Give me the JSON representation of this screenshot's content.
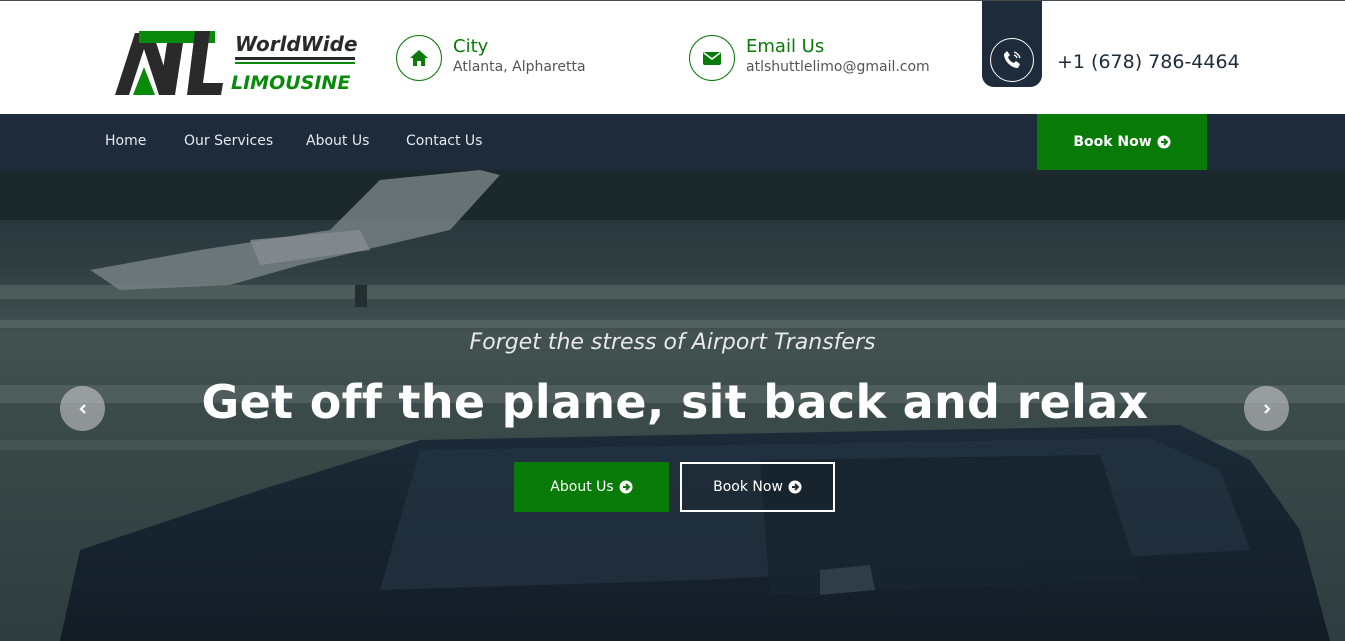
{
  "brand": {
    "logo_text": "ATL",
    "logo_line1": "WorldWide",
    "logo_line2": "LIMOUSINE"
  },
  "header": {
    "city": {
      "icon": "home-icon",
      "title": "City",
      "value": "Atlanta, Alpharetta"
    },
    "email": {
      "icon": "envelope-icon",
      "title": "Email Us",
      "value": "atlshuttlelimo@gmail.com"
    },
    "phone": {
      "icon": "phone-icon",
      "value": "+1 (678) 786-4464"
    }
  },
  "nav": {
    "items": [
      {
        "label": "Home"
      },
      {
        "label": "Our Services"
      },
      {
        "label": "About Us"
      },
      {
        "label": "Contact Us"
      }
    ],
    "book_label": "Book Now"
  },
  "hero": {
    "subtitle": "Forget the stress of Airport Transfers",
    "title": "Get off the plane, sit back and relax",
    "buttons": {
      "about_label": "About Us",
      "book_label": "Book Now"
    },
    "prev_icon": "chevron-left-icon",
    "next_icon": "chevron-right-icon"
  },
  "colors": {
    "brand_green": "#077a08",
    "navy": "#1d2b3a",
    "white": "#ffffff"
  }
}
